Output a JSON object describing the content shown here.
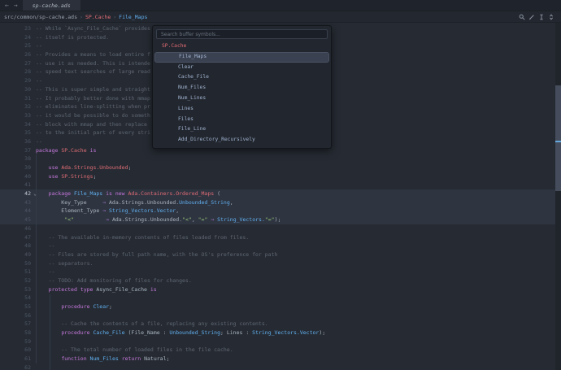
{
  "tab_bar": {
    "back_arrow": "←",
    "forward_arrow": "→",
    "tab_label": "sp-cache.ads"
  },
  "breadcrumb": {
    "file_path": "src/common/sp-cache.ads",
    "separator": "›",
    "package_segment": "SP.Cache",
    "symbol_segment": "File_Maps",
    "icons": [
      "search-icon",
      "pencil-icon",
      "ibeam-icon",
      "sort-arrows-icon"
    ]
  },
  "palette": {
    "placeholder": "Search buffer symbols...",
    "value": "",
    "items": [
      {
        "label": "SP.Cache",
        "kind": "parent",
        "selected": false
      },
      {
        "label": "File_Maps",
        "kind": "child",
        "selected": true
      },
      {
        "label": "Clear",
        "kind": "child",
        "selected": false
      },
      {
        "label": "Cache_File",
        "kind": "child",
        "selected": false
      },
      {
        "label": "Num_Files",
        "kind": "child",
        "selected": false
      },
      {
        "label": "Num_Lines",
        "kind": "child",
        "selected": false
      },
      {
        "label": "Lines",
        "kind": "child",
        "selected": false
      },
      {
        "label": "Files",
        "kind": "child",
        "selected": false
      },
      {
        "label": "File_Line",
        "kind": "child",
        "selected": false
      },
      {
        "label": "Add_Directory_Recursively",
        "kind": "child",
        "selected": false
      }
    ]
  },
  "editor": {
    "current_line": 42,
    "fold_chevron": "⌄",
    "highlight_lines": [
      42,
      43,
      44,
      45
    ],
    "lines": [
      {
        "n": 23,
        "tokens": [
          [
            "c",
            "-- While `Async_File_Cache` provides"
          ]
        ]
      },
      {
        "n": 24,
        "tokens": [
          [
            "c",
            "-- itself is protected."
          ]
        ]
      },
      {
        "n": 25,
        "tokens": [
          [
            "c",
            "--"
          ]
        ]
      },
      {
        "n": 26,
        "tokens": [
          [
            "c",
            "-- Provides a means to load entire f"
          ]
        ]
      },
      {
        "n": 27,
        "tokens": [
          [
            "c",
            "-- use it as needed. This is intende"
          ]
        ]
      },
      {
        "n": 28,
        "tokens": [
          [
            "c",
            "-- speed text searches of large read"
          ]
        ]
      },
      {
        "n": 29,
        "tokens": [
          [
            "c",
            "--"
          ]
        ]
      },
      {
        "n": 30,
        "tokens": [
          [
            "c",
            "-- This is super simple and straight"
          ]
        ]
      },
      {
        "n": 31,
        "tokens": [
          [
            "c",
            "-- It probably better done with mmap"
          ]
        ]
      },
      {
        "n": 32,
        "tokens": [
          [
            "c",
            "-- eliminates line-splitting when pr"
          ]
        ]
      },
      {
        "n": 33,
        "tokens": [
          [
            "c",
            "-- it would be possible to do someth"
          ]
        ]
      },
      {
        "n": 34,
        "tokens": [
          [
            "c",
            "-- block with mmap and then replace "
          ]
        ]
      },
      {
        "n": 35,
        "tokens": [
          [
            "c",
            "-- to the initial part of every stri"
          ]
        ]
      },
      {
        "n": 36,
        "tokens": [
          [
            "c",
            "--"
          ]
        ]
      },
      {
        "n": 37,
        "tokens": [
          [
            "k",
            "package "
          ],
          [
            "r",
            "SP.Cache"
          ],
          [
            "k",
            " is"
          ]
        ]
      },
      {
        "n": 38,
        "tokens": []
      },
      {
        "n": 39,
        "tokens": [
          [
            "p",
            "    "
          ],
          [
            "k",
            "use "
          ],
          [
            "r",
            "Ada.Strings.Unbounded"
          ],
          [
            "p",
            ";"
          ]
        ]
      },
      {
        "n": 40,
        "tokens": [
          [
            "p",
            "    "
          ],
          [
            "k",
            "use "
          ],
          [
            "r",
            "SP.Strings"
          ],
          [
            "p",
            ";"
          ]
        ]
      },
      {
        "n": 41,
        "tokens": []
      },
      {
        "n": 42,
        "tokens": [
          [
            "p",
            "    "
          ],
          [
            "k",
            "package "
          ],
          [
            "b",
            "File_Maps"
          ],
          [
            "k",
            " is new "
          ],
          [
            "r",
            "Ada.Containers.Ordered_Maps"
          ],
          [
            "p",
            " ("
          ]
        ]
      },
      {
        "n": 43,
        "tokens": [
          [
            "p",
            "        Key_Type     "
          ],
          [
            "a",
            "⇒"
          ],
          [
            "p",
            " Ada.Strings.Unbounded."
          ],
          [
            "b",
            "Unbounded_String"
          ],
          [
            "p",
            ","
          ]
        ]
      },
      {
        "n": 44,
        "tokens": [
          [
            "p",
            "        Element_Type "
          ],
          [
            "a",
            "⇒"
          ],
          [
            "p",
            " "
          ],
          [
            "b",
            "String_Vectors.Vector"
          ],
          [
            "p",
            ","
          ]
        ]
      },
      {
        "n": 45,
        "tokens": [
          [
            "p",
            "         "
          ],
          [
            "g",
            "\"<\""
          ],
          [
            "p",
            "          "
          ],
          [
            "a",
            "⇒"
          ],
          [
            "p",
            " Ada.Strings.Unbounded."
          ],
          [
            "g",
            "\"<\""
          ],
          [
            "p",
            ", "
          ],
          [
            "g",
            "\"=\""
          ],
          [
            "p",
            " "
          ],
          [
            "a",
            "⇒"
          ],
          [
            "p",
            " "
          ],
          [
            "b",
            "String_Vectors."
          ],
          [
            "g",
            "\"=\""
          ],
          [
            "p",
            ");"
          ]
        ]
      },
      {
        "n": 46,
        "tokens": []
      },
      {
        "n": 47,
        "tokens": [
          [
            "c",
            "    -- The available in-memory contents of files loaded from files."
          ]
        ]
      },
      {
        "n": 48,
        "tokens": [
          [
            "c",
            "    --"
          ]
        ]
      },
      {
        "n": 49,
        "tokens": [
          [
            "c",
            "    -- Files are stored by full path name, with the OS's preference for path"
          ]
        ]
      },
      {
        "n": 50,
        "tokens": [
          [
            "c",
            "    -- separators."
          ]
        ]
      },
      {
        "n": 51,
        "tokens": [
          [
            "c",
            "    --"
          ]
        ]
      },
      {
        "n": 52,
        "tokens": [
          [
            "c",
            "    -- TODO: Add monitoring of files for changes."
          ]
        ]
      },
      {
        "n": 53,
        "tokens": [
          [
            "p",
            "    "
          ],
          [
            "k",
            "protected type "
          ],
          [
            "p",
            "Async_File_Cache"
          ],
          [
            "k",
            " is"
          ]
        ]
      },
      {
        "n": 54,
        "tokens": []
      },
      {
        "n": 55,
        "tokens": [
          [
            "p",
            "        "
          ],
          [
            "k",
            "procedure "
          ],
          [
            "b",
            "Clear"
          ],
          [
            "p",
            ";"
          ]
        ]
      },
      {
        "n": 56,
        "tokens": []
      },
      {
        "n": 57,
        "tokens": [
          [
            "c",
            "        -- Cache the contents of a file, replacing any existing contents."
          ]
        ]
      },
      {
        "n": 58,
        "tokens": [
          [
            "p",
            "        "
          ],
          [
            "k",
            "procedure "
          ],
          [
            "b",
            "Cache_File"
          ],
          [
            "p",
            " (File_Name : "
          ],
          [
            "b",
            "Unbounded_String"
          ],
          [
            "p",
            "; Lines : "
          ],
          [
            "b",
            "String_Vectors.Vector"
          ],
          [
            "p",
            ");"
          ]
        ]
      },
      {
        "n": 59,
        "tokens": []
      },
      {
        "n": 60,
        "tokens": [
          [
            "c",
            "        -- The total number of loaded files in the file cache."
          ]
        ]
      },
      {
        "n": 61,
        "tokens": [
          [
            "p",
            "        "
          ],
          [
            "k",
            "function "
          ],
          [
            "b",
            "Num_Files"
          ],
          [
            "k",
            " return "
          ],
          [
            "p",
            "Natural;"
          ]
        ]
      },
      {
        "n": 62,
        "tokens": []
      }
    ]
  },
  "colors": {
    "editor_bg": "#262b33",
    "highlight_row": "#2e3440",
    "keyword": "#c678dd",
    "module_red": "#e06c75",
    "entity_blue": "#61afef",
    "string_green": "#98c379",
    "comment_grey": "#5f6672",
    "selection_marker_blue": "#64a8dd"
  }
}
